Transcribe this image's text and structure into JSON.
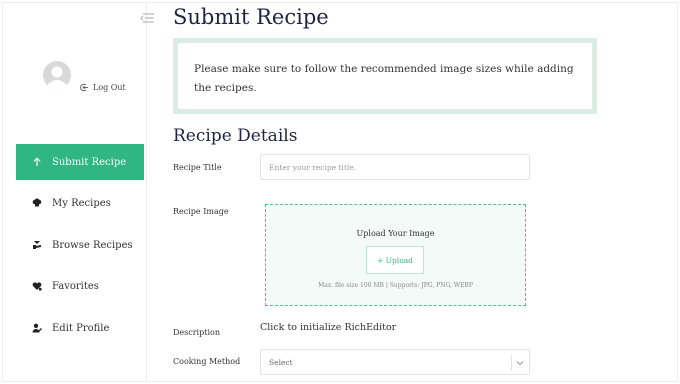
{
  "sidebar": {
    "logout_label": "Log Out",
    "items": [
      {
        "label": "Submit Recipe",
        "icon": "arrow-up-icon",
        "active": true
      },
      {
        "label": "My Recipes",
        "icon": "chef-hat-icon",
        "active": false
      },
      {
        "label": "Browse Recipes",
        "icon": "browse-icon",
        "active": false
      },
      {
        "label": "Favorites",
        "icon": "heart-icon",
        "active": false
      },
      {
        "label": "Edit Profile",
        "icon": "user-edit-icon",
        "active": false
      }
    ]
  },
  "main": {
    "title": "Submit Recipe",
    "notice": "Please make sure to follow the recommended image sizes while adding the recipes.",
    "section_title": "Recipe Details",
    "recipe_title": {
      "label": "Recipe Title",
      "placeholder": "Enter your recipe title.",
      "value": ""
    },
    "recipe_image": {
      "label": "Recipe Image",
      "upload_title": "Upload Your Image",
      "upload_button": "+ Upload",
      "hint": "Max. file size 100 MB | Supports: JPG, PNG, WEBP"
    },
    "description": {
      "label": "Description",
      "editor_text": "Click to initialize RichEditor"
    },
    "cooking_method": {
      "label": "Cooking Method",
      "selected": "Select"
    }
  },
  "colors": {
    "accent": "#2fb682",
    "notice_border": "#d9ede5",
    "upload_bg": "#f3faf7",
    "title": "#1f2440"
  }
}
